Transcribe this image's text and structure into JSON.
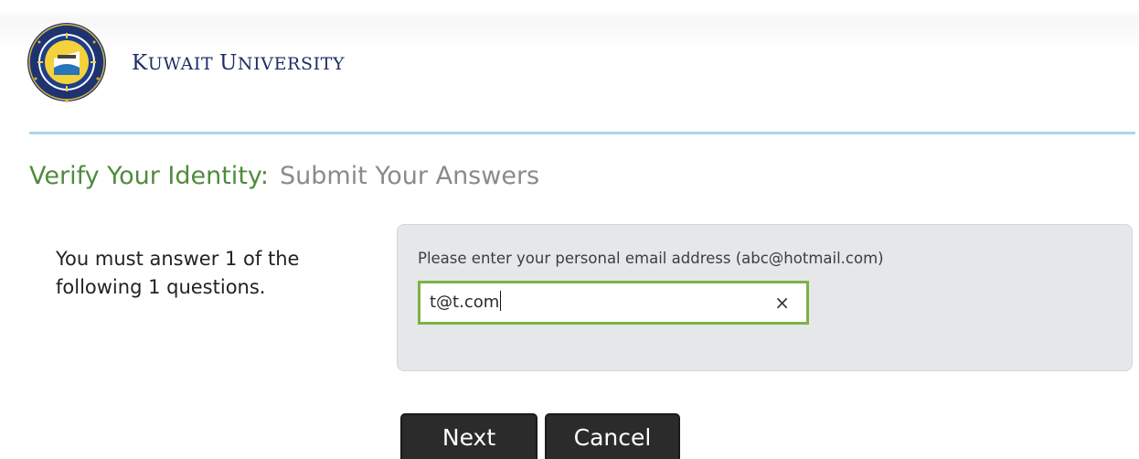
{
  "header": {
    "brand_initial": "K",
    "brand_rest_1": "UWAIT",
    "brand_initial_2": "U",
    "brand_rest_2": "NIVERSITY",
    "colors": {
      "brand_text": "#1f2e63",
      "rule": "#a9d8ea"
    }
  },
  "page": {
    "title": "Verify Your Identity:",
    "subtitle": "Submit Your Answers",
    "instruction": "You must answer 1 of the following 1 questions.",
    "colors": {
      "title": "#4f8b3e",
      "subtitle": "#8a8a8a"
    }
  },
  "question": {
    "label": "Please enter your personal email address (abc@hotmail.com)",
    "value": "t@t.com",
    "clear_icon": "×",
    "colors": {
      "focus_border": "#7cb342",
      "panel": "#e6e7e9"
    }
  },
  "buttons": {
    "next_label": "Next",
    "cancel_label": "Cancel",
    "colors": {
      "background": "#2b2b2b",
      "text": "#ffffff"
    }
  }
}
